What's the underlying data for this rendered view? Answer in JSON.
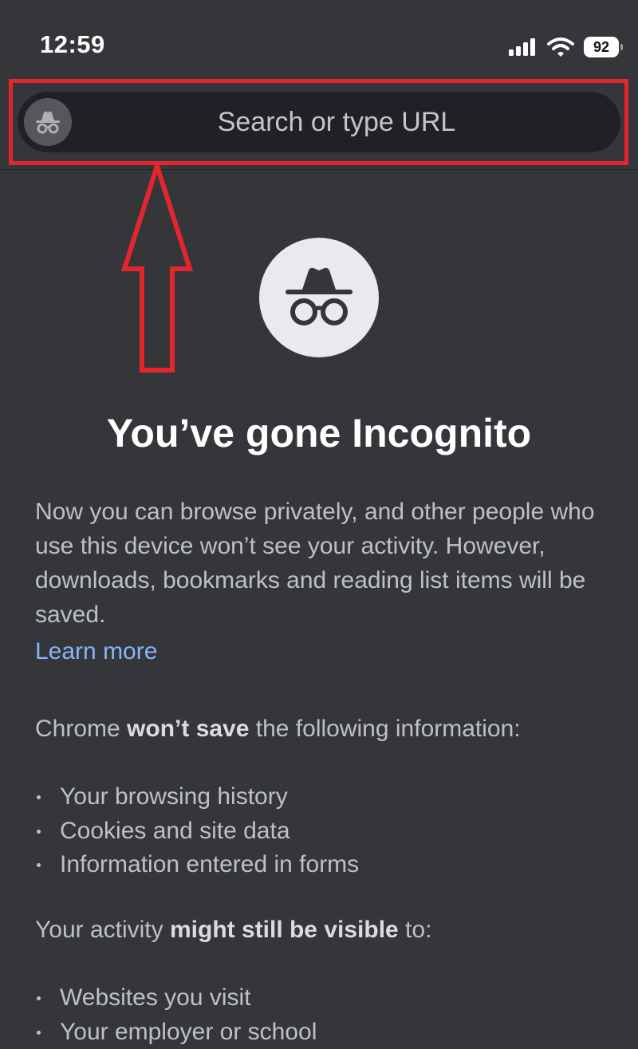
{
  "status_bar": {
    "time": "12:59",
    "battery_level": "92",
    "icons": [
      "cellular-signal-icon",
      "wifi-icon",
      "battery-icon"
    ]
  },
  "toolbar": {
    "search_placeholder": "Search or type URL",
    "mode_icon": "incognito-icon"
  },
  "annotation": {
    "color": "#e3262e",
    "shapes": [
      "highlight-frame",
      "up-arrow"
    ]
  },
  "page": {
    "hero_icon": "incognito-icon",
    "title": "You’ve gone Incognito",
    "intro": "Now you can browse privately, and other people who use this device won’t see your activity. However, downloads, bookmarks and reading list items will be saved.",
    "learn_more": "Learn more",
    "wont_save": {
      "prefix": "Chrome ",
      "emphasis": "won’t save",
      "suffix": " the following information:",
      "items": [
        "Your browsing history",
        "Cookies and site data",
        "Information entered in forms"
      ]
    },
    "still_visible": {
      "prefix": "Your activity ",
      "emphasis": "might still be visible",
      "suffix": " to:",
      "items": [
        "Websites you visit",
        "Your employer or school"
      ]
    }
  },
  "colors": {
    "background": "#35363a",
    "omnibox": "#202124",
    "link": "#8ab4f8",
    "annotation": "#e3262e"
  }
}
